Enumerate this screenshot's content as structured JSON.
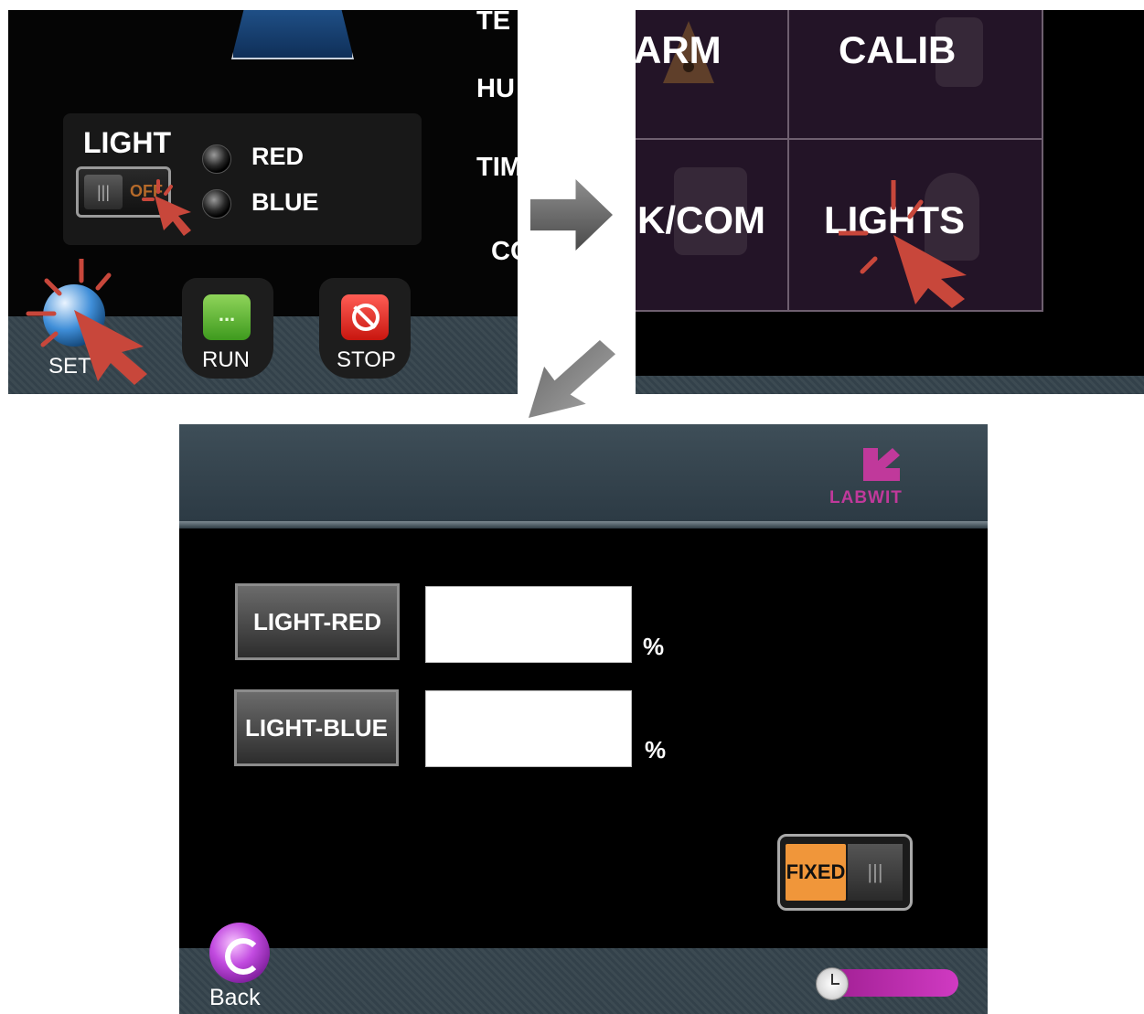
{
  "panel_a": {
    "menu_letters": [
      "TE",
      "HU",
      "TIM",
      "CO"
    ],
    "light_box": {
      "title": "LIGHT",
      "toggle_state": "OFF",
      "toggle_grip": "|||",
      "leds": [
        {
          "label": "RED"
        },
        {
          "label": "BLUE"
        }
      ]
    },
    "buttons": {
      "set": "SET",
      "run": "RUN",
      "run_glyph": "...",
      "stop": "STOP"
    }
  },
  "panel_b": {
    "cells": [
      "ARM",
      "CALIB",
      "K/COM",
      "LIGHTS"
    ]
  },
  "panel_c": {
    "logo_text": "LABWIT",
    "rows": [
      {
        "button": "LIGHT-RED",
        "value": "",
        "unit": "%"
      },
      {
        "button": "LIGHT-BLUE",
        "value": "",
        "unit": "%"
      }
    ],
    "mode_toggle": {
      "label": "FIXED",
      "grip": "|||"
    },
    "back_label": "Back"
  },
  "colors": {
    "accent_orange": "#f0963a",
    "brand_magenta": "#c0399b",
    "cursor_red": "#c8473b",
    "screen_black": "#000000",
    "menu_purple": "#231427"
  },
  "icons": [
    "cursor-click-icon",
    "globe-set-icon",
    "run-icon",
    "stop-icon",
    "back-icon",
    "clock-icon",
    "labwit-logo-icon",
    "alarm-icon",
    "calib-icon",
    "lock-com-icon",
    "bulb-icon"
  ]
}
